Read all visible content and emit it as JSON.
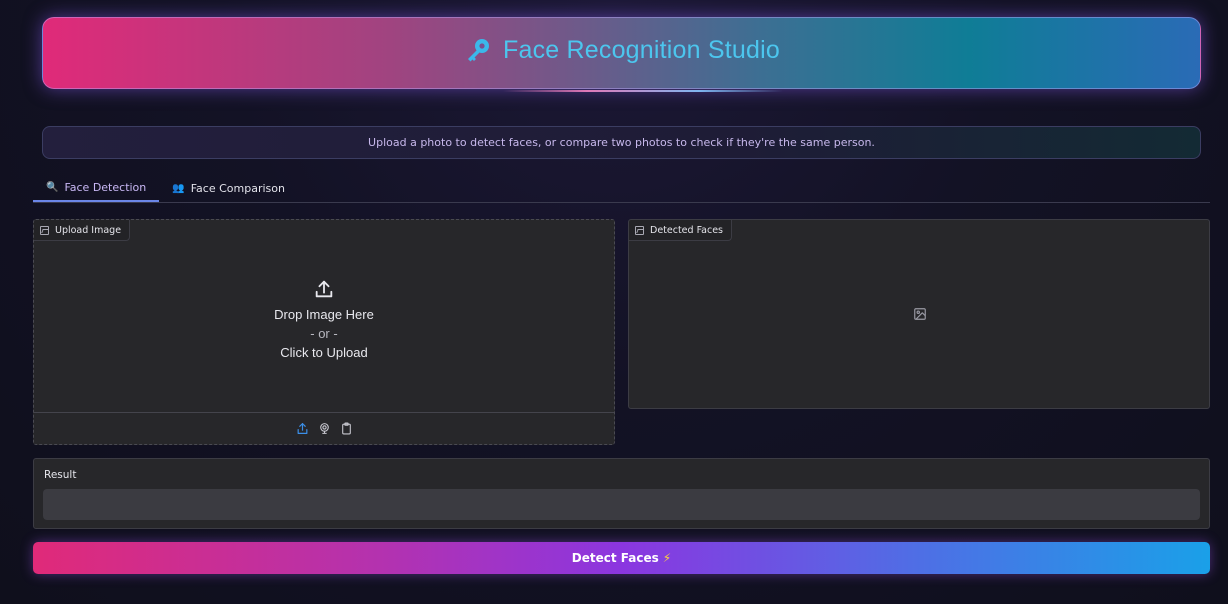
{
  "header": {
    "title": "Face Recognition Studio",
    "title_icon": "key-icon",
    "title_color": "#4cc6ee"
  },
  "info": {
    "text": "Upload a photo to detect faces, or compare two photos to check if they're the same person."
  },
  "tabs": [
    {
      "label": "Face Detection",
      "icon": "magnifier-icon",
      "active": true
    },
    {
      "label": "Face Comparison",
      "icon": "people-icon",
      "active": false
    }
  ],
  "upload_panel": {
    "label": "Upload Image",
    "drop_text": "Drop Image Here",
    "or_text": "- or -",
    "click_text": "Click to Upload",
    "sources": [
      "upload-icon",
      "webcam-icon",
      "clipboard-icon"
    ]
  },
  "faces_panel": {
    "label": "Detected Faces"
  },
  "result": {
    "label": "Result",
    "value": ""
  },
  "action": {
    "label": "Detect Faces",
    "emoji": "⚡"
  },
  "colors": {
    "accent_pink": "#e02a79",
    "accent_blue": "#1aa0e8",
    "panel_bg": "#27272a",
    "page_bg": "#131225"
  }
}
